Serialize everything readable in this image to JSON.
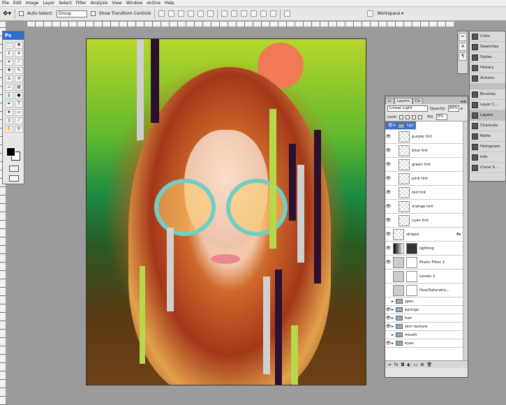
{
  "menu": [
    "File",
    "Edit",
    "Image",
    "Layer",
    "Select",
    "Filter",
    "Analysis",
    "View",
    "Window",
    "onOne",
    "Help"
  ],
  "options": {
    "auto_select_label": "Auto-Select:",
    "auto_select_value": "Group",
    "transform_label": "Show Transform Controls",
    "workspace_label": "Workspace ▾"
  },
  "toolbox": {
    "logo": "Ps"
  },
  "dock": {
    "group1": [
      "Color",
      "Swatches",
      "Styles",
      "History",
      "Actions"
    ],
    "group2": [
      "Brushes",
      "Layer C...",
      "Layers",
      "Channels",
      "Paths",
      "Histogram",
      "Info",
      "Clone S..."
    ]
  },
  "layers_panel": {
    "tabs": [
      "Li",
      "Layers",
      "Ch"
    ],
    "blend_mode": "Linear Light",
    "opacity_label": "Opacity:",
    "opacity_value": "60%",
    "lock_label": "Lock:",
    "fill_label": "Fill:",
    "fill_value": "0%",
    "rows": [
      {
        "name": "lights",
        "type": "group",
        "selected": true
      },
      {
        "name": "purple tint"
      },
      {
        "name": "blue tint"
      },
      {
        "name": "green tint"
      },
      {
        "name": "pink tint"
      },
      {
        "name": "red tint"
      },
      {
        "name": "orange tint"
      },
      {
        "name": "cyan tint"
      },
      {
        "name": "stripes",
        "fx": "fx"
      },
      {
        "name": "lighting"
      },
      {
        "name": "Photo Filter 2"
      },
      {
        "name": "Levels 1"
      },
      {
        "name": "Hue/Saturatio..."
      },
      {
        "name": "spec",
        "type": "group"
      },
      {
        "name": "earings",
        "type": "group"
      },
      {
        "name": "hair",
        "type": "group"
      },
      {
        "name": "skin texture",
        "type": "group"
      },
      {
        "name": "mouth",
        "type": "group"
      },
      {
        "name": "eyes",
        "type": "group"
      }
    ]
  },
  "colors": {
    "accent": "#3a6fd2",
    "canvas_bg": "#9b9b9b"
  }
}
